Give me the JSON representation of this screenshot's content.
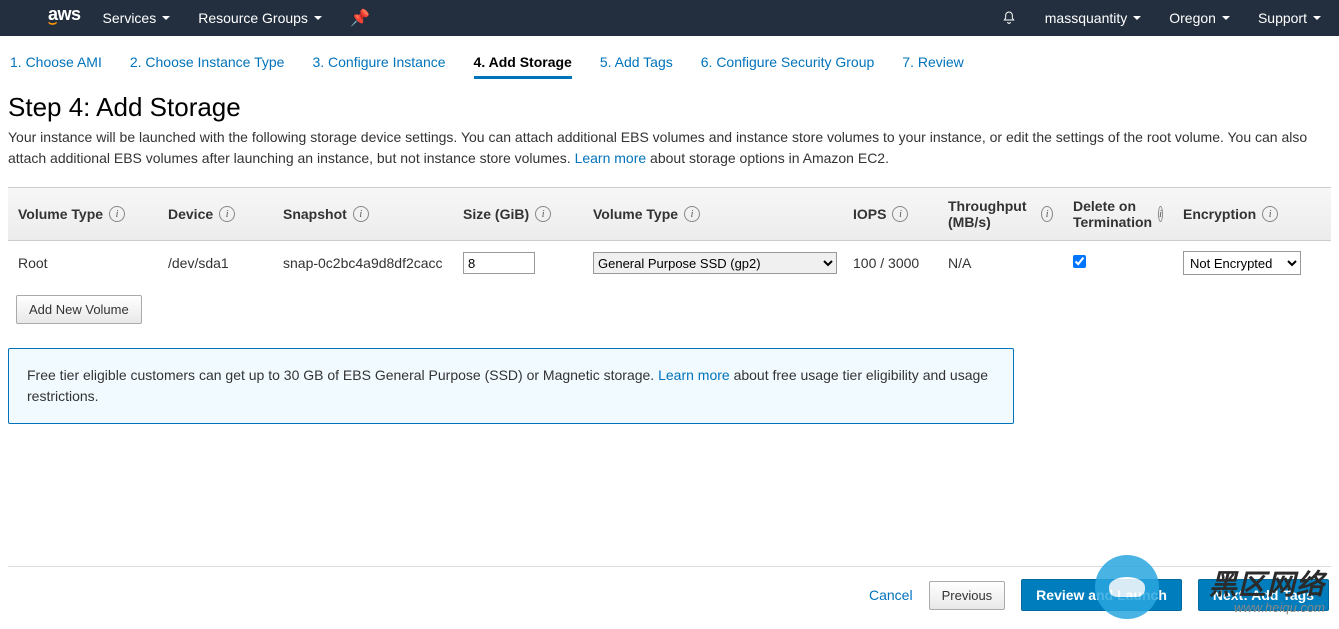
{
  "topnav": {
    "logo": "aws",
    "services": "Services",
    "resource_groups": "Resource Groups",
    "user": "massquantity",
    "region": "Oregon",
    "support": "Support"
  },
  "wizard": {
    "tabs": [
      "1. Choose AMI",
      "2. Choose Instance Type",
      "3. Configure Instance",
      "4. Add Storage",
      "5. Add Tags",
      "6. Configure Security Group",
      "7. Review"
    ],
    "active_index": 3
  },
  "page": {
    "title": "Step 4: Add Storage",
    "desc_1": "Your instance will be launched with the following storage device settings. You can attach additional EBS volumes and instance store volumes to your instance, or edit the settings of the root volume. You can also attach additional EBS volumes after launching an instance, but not instance store volumes.",
    "learn_more": "Learn more",
    "desc_2": " about storage options in Amazon EC2."
  },
  "table": {
    "headers": {
      "volume_type": "Volume Type",
      "device": "Device",
      "snapshot": "Snapshot",
      "size": "Size (GiB)",
      "volume_type2": "Volume Type",
      "iops": "IOPS",
      "throughput": "Throughput (MB/s)",
      "delete_term": "Delete on Termination",
      "encryption": "Encryption"
    },
    "rows": [
      {
        "vt1": "Root",
        "device": "/dev/sda1",
        "snapshot": "snap-0c2bc4a9d8df2cacc",
        "size": "8",
        "vt2": "General Purpose SSD (gp2)",
        "iops": "100 / 3000",
        "throughput": "N/A",
        "delete_checked": true,
        "encryption": "Not Encrypted"
      }
    ],
    "add_button": "Add New Volume"
  },
  "notice": {
    "text1": "Free tier eligible customers can get up to 30 GB of EBS General Purpose (SSD) or Magnetic storage. ",
    "learn_more": "Learn more",
    "text2": " about free usage tier eligibility and usage restrictions."
  },
  "footer": {
    "cancel": "Cancel",
    "previous": "Previous",
    "review": "Review and Launch",
    "next": "Next: Add Tags"
  },
  "watermark": {
    "line1": "黑区网络",
    "line2": "www.heiqu.com"
  }
}
